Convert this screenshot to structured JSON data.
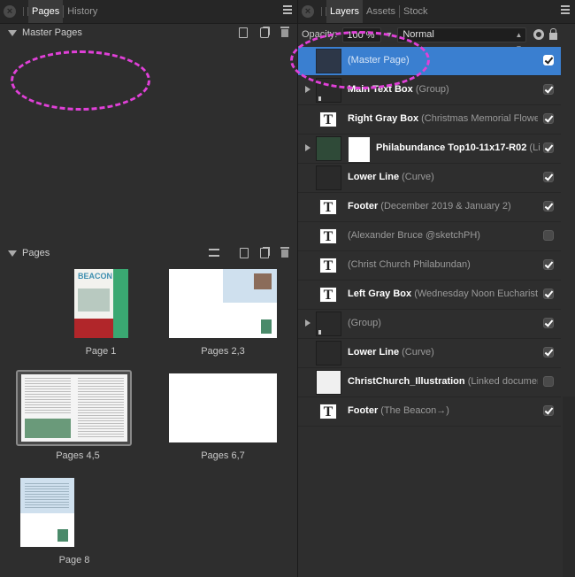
{
  "left_panel": {
    "tabs": [
      {
        "label": "Pages",
        "active": true
      },
      {
        "label": "History",
        "active": false
      }
    ],
    "master_pages": {
      "title": "Master Pages"
    },
    "pages_section": {
      "title": "Pages"
    },
    "pages": [
      {
        "label": "Page 1"
      },
      {
        "label": "Pages 2,3"
      },
      {
        "label": "Pages 4,5",
        "selected": true
      },
      {
        "label": "Pages 6,7"
      },
      {
        "label": "Page 8"
      }
    ]
  },
  "right_panel": {
    "tabs": [
      {
        "label": "Layers",
        "active": true
      },
      {
        "label": "Assets",
        "active": false
      },
      {
        "label": "Stock",
        "active": false
      }
    ],
    "opacity_label": "Opacity:",
    "opacity_value": "100 %",
    "blend_mode": "Normal",
    "layers": [
      {
        "name": "",
        "detail": "(Master Page)",
        "thumb": "blank",
        "expand": false,
        "visible": true,
        "selected": true
      },
      {
        "name": "Main Text Box",
        "detail": "(Group)",
        "thumb": "group",
        "expand": true,
        "visible": true
      },
      {
        "name": "Right Gray Box",
        "detail": "(Christmas Memorial Flower",
        "thumb": "text",
        "expand": false,
        "visible": true
      },
      {
        "name": "Philabundance Top10-11x17-R02",
        "detail": "(Li",
        "thumb": "image",
        "expand": true,
        "visible": true
      },
      {
        "name": "Lower Line",
        "detail": "(Curve)",
        "thumb": "blank",
        "expand": false,
        "visible": true
      },
      {
        "name": "Footer",
        "detail": "(December 2019 & January 2)",
        "thumb": "text",
        "expand": false,
        "visible": true
      },
      {
        "name": "",
        "detail": "(Alexander Bruce @sketchPH)",
        "thumb": "text",
        "expand": false,
        "visible": false
      },
      {
        "name": "",
        "detail": "(Christ Church Philabundan)",
        "thumb": "text",
        "expand": false,
        "visible": true
      },
      {
        "name": "Left Gray Box",
        "detail": "(Wednesday Noon Eucharist¶",
        "thumb": "text",
        "expand": false,
        "visible": true
      },
      {
        "name": "",
        "detail": "(Group)",
        "thumb": "group",
        "expand": true,
        "visible": true
      },
      {
        "name": "Lower Line",
        "detail": "(Curve)",
        "thumb": "blank",
        "expand": false,
        "visible": true
      },
      {
        "name": "ChristChurch_Illustration",
        "detail": "(Linked documen",
        "thumb": "illustration",
        "expand": false,
        "visible": false
      },
      {
        "name": "Footer",
        "detail": "(The Beacon→)",
        "thumb": "text",
        "expand": false,
        "visible": true
      }
    ]
  },
  "thumbnail_texts": {
    "page1_masthead": "BEACON"
  },
  "colors": {
    "selection": "#3a7fd0",
    "annotation": "#e040d8",
    "panel_bg": "#2e2e2e"
  }
}
